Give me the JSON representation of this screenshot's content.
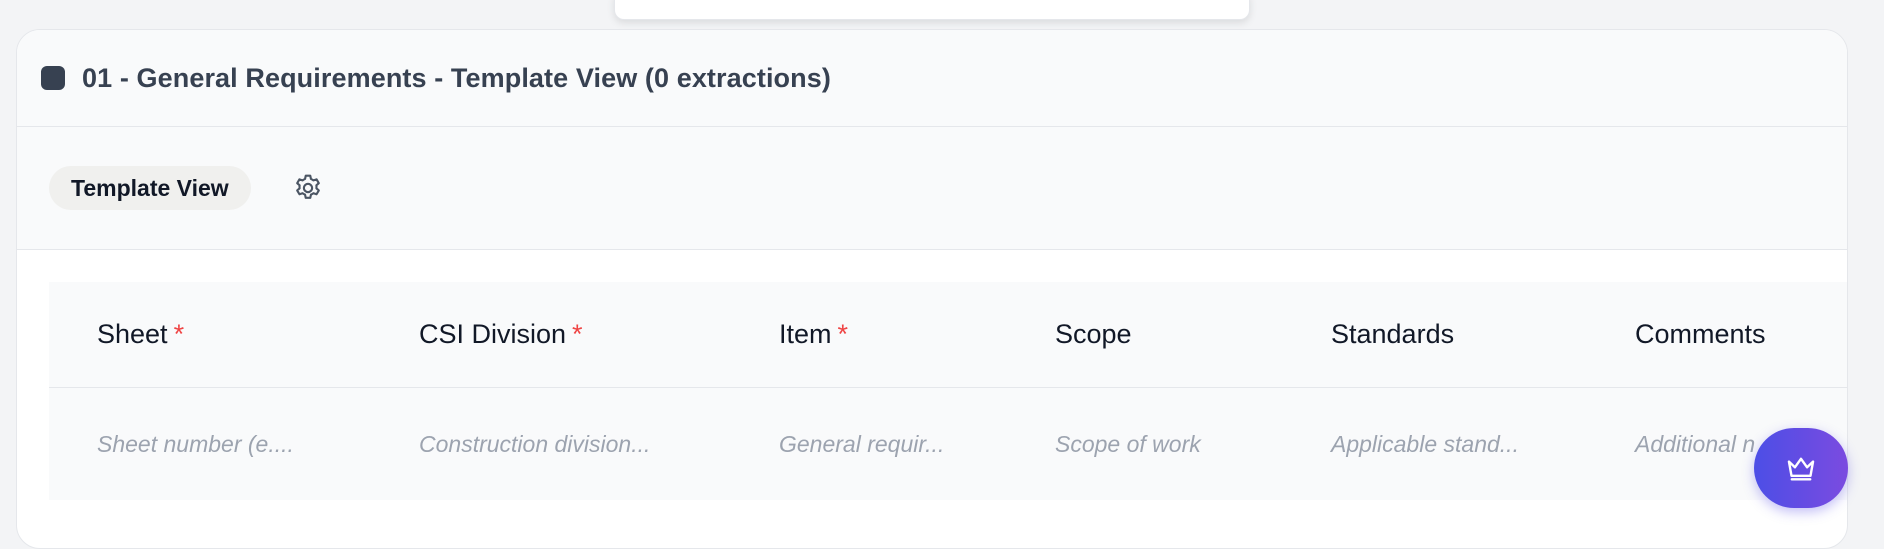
{
  "card": {
    "title": "01 - General Requirements - Template View (0 extractions)"
  },
  "toolbar": {
    "view_label": "Template View",
    "settings_icon": "gear-icon"
  },
  "table": {
    "columns": [
      {
        "label": "Sheet",
        "required": "*",
        "placeholder": "Sheet number (e...."
      },
      {
        "label": "CSI Division",
        "required": "*",
        "placeholder": "Construction division..."
      },
      {
        "label": "Item",
        "required": "*",
        "placeholder": "General requir..."
      },
      {
        "label": "Scope",
        "required": "",
        "placeholder": "Scope of work"
      },
      {
        "label": "Standards",
        "required": "",
        "placeholder": "Applicable stand..."
      },
      {
        "label": "Comments",
        "required": "",
        "placeholder": "Additional n"
      }
    ]
  },
  "fab": {
    "icon": "crown-icon"
  },
  "colors": {
    "accent_start": "#4c4ee6",
    "accent_end": "#7b4be0",
    "required": "#ef4444",
    "status": "#374151"
  }
}
